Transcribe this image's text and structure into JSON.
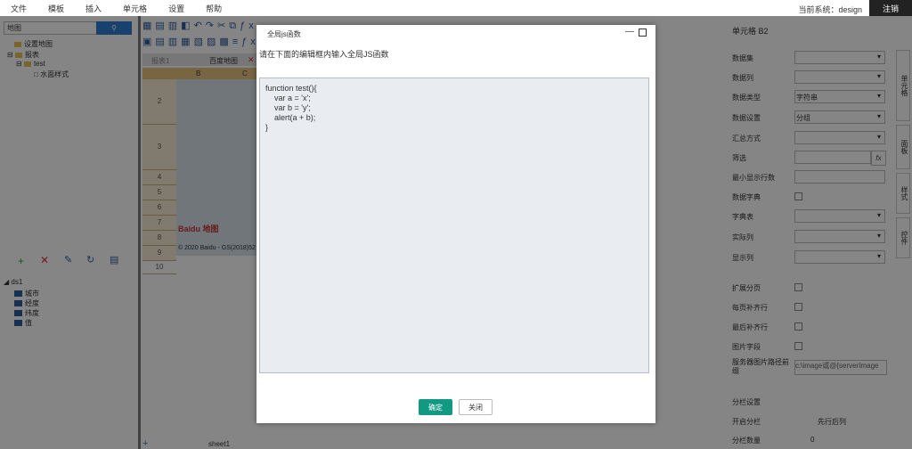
{
  "menu": [
    "文件",
    "模板",
    "插入",
    "单元格",
    "设置",
    "帮助"
  ],
  "user": "当前系统：design",
  "logout": "注销",
  "left": {
    "search_value": "地图",
    "search_button": "",
    "tree": [
      "设置地图",
      "报表",
      "test",
      "水面样式"
    ],
    "datasets": [
      "ds1",
      "城市",
      "经度",
      "纬度",
      "值"
    ]
  },
  "sheet": {
    "tabs": [
      "报表1",
      "百度地图"
    ],
    "col_headers": [
      "B",
      "C"
    ],
    "rows": [
      "2",
      "3",
      "4",
      "5",
      "6",
      "7",
      "8",
      "9",
      "10"
    ],
    "map_label": "Baidu 地图",
    "map_copyright": "© 2020 Baidu - GS(2018)52",
    "sheet_tab": "sheet1",
    "add_sheet": "+"
  },
  "right": {
    "title": "单元格 B2",
    "labels": [
      "数据集",
      "数据列",
      "数据类型",
      "数据设置",
      "汇总方式",
      "筛选",
      "最小显示行数",
      "数据字典",
      "字典表",
      "实际列",
      "显示列",
      "扩展分页",
      "每页补齐行",
      "最后补齐行",
      "图片字段",
      "服务器图片路径前缀",
      "分栏设置",
      "开启分栏",
      "分栏数量"
    ],
    "data_type_value": "字符串",
    "data_setting_value": "分组",
    "image_prefix_placeholder": "c:\\image或@{serverImage",
    "column_order": "先行后列",
    "column_count": "0",
    "side_tabs": [
      "单元格",
      "面板",
      "样式",
      "控件"
    ]
  },
  "dialog": {
    "title": "全局js函数",
    "instruction": "请在下面的编辑框内输入全局JS函数",
    "code": [
      "function test(){",
      "    var a = 'x';",
      "    var b = 'y';",
      "    alert(a + b);",
      "}"
    ],
    "ok": "确定",
    "close": "关闭"
  }
}
